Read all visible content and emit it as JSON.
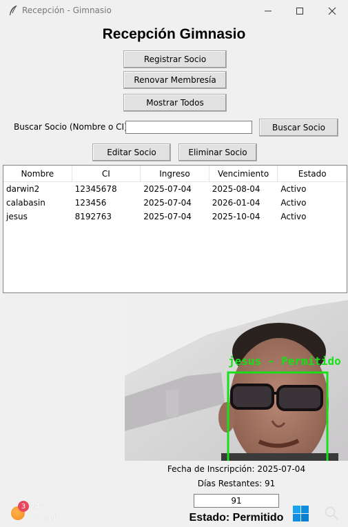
{
  "window": {
    "title": "Recepción - Gimnasio",
    "minimize_icon": "minimize-icon",
    "maximize_icon": "maximize-icon",
    "close_icon": "close-icon"
  },
  "header": {
    "title": "Recepción Gimnasio"
  },
  "buttons": {
    "register": "Registrar Socio",
    "renew": "Renovar Membresía",
    "show_all": "Mostrar Todos",
    "search": "Buscar Socio",
    "edit": "Editar Socio",
    "delete": "Eliminar Socio"
  },
  "search": {
    "label": "Buscar Socio (Nombre o CI):",
    "value": ""
  },
  "table": {
    "columns": [
      "Nombre",
      "CI",
      "Ingreso",
      "Vencimiento",
      "Estado"
    ],
    "rows": [
      [
        "darwin2",
        "12345678",
        "2025-07-04",
        "2025-08-04",
        "Activo"
      ],
      [
        "calabasin",
        "123456",
        "2025-07-04",
        "2026-01-04",
        "Activo"
      ],
      [
        "jesus",
        "8192763",
        "2025-07-04",
        "2025-10-04",
        "Activo"
      ]
    ]
  },
  "camera": {
    "overlay_label": "jesus - Permitido",
    "box_color": "#16e016"
  },
  "details": {
    "inscription": "Fecha de Inscripción: 2025-07-04",
    "remaining": "Días Restantes: 91",
    "remaining_value": "91",
    "status": "Estado: Permitido"
  },
  "taskbar": {
    "weather_badge": "3",
    "temperature": "24°C",
    "condition": "Soleado",
    "icons": [
      "weather-icon",
      "windows-start-icon",
      "search-icon"
    ]
  },
  "colors": {
    "window_bg": "#f0f0f0",
    "button_bg": "#e1e1e1",
    "start_blue": "#0a8fe6"
  }
}
